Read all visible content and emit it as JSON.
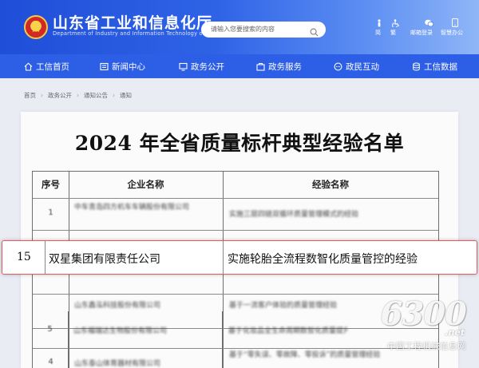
{
  "header": {
    "title": "山东省工业和信息化厅",
    "subtitle": "Department of Industry and Information Technology of Shandong Province",
    "search_placeholder": "请输入您要搜索的内容",
    "tools": [
      {
        "icon": "elder-mode-icon",
        "label": "简"
      },
      {
        "icon": "accessibility-icon",
        "label": "繁"
      },
      {
        "icon": "wechat-icon",
        "label": "邮箱登录"
      },
      {
        "icon": "phone-icon",
        "label": "智慧办公"
      }
    ]
  },
  "nav": {
    "items": [
      {
        "icon": "home-icon",
        "label": "工信首页"
      },
      {
        "icon": "news-icon",
        "label": "新闻中心"
      },
      {
        "icon": "monitor-icon",
        "label": "政务公开"
      },
      {
        "icon": "service-icon",
        "label": "政务服务"
      },
      {
        "icon": "chat-icon",
        "label": "政民互动"
      },
      {
        "icon": "data-icon",
        "label": "工信数据"
      }
    ]
  },
  "breadcrumb": [
    "首页",
    "政务公开",
    "通知公告",
    "通知"
  ],
  "document": {
    "title": "2024 年全省质量标杆典型经验名单",
    "table": {
      "headers": [
        "序号",
        "企业名称",
        "经验名称"
      ],
      "rows": [
        {
          "no": "1",
          "company": "中车青岛四方机车车辆股份有限公司",
          "experience": "实施三层四链双循环质量管理模式的经验"
        },
        {
          "no": "",
          "company": "",
          "experience": ""
        },
        {
          "no": "",
          "company": "山东鑫泓科技股份有限公司",
          "experience": "基于一流客户体验的质量管理经验"
        },
        {
          "no": "4",
          "company": "山东泰山体育器材有限公司",
          "experience": "基于“零失误、零故障、零投诉”的质量管理经验"
        },
        {
          "no": "5",
          "company": "山东福瑞达生物股份有限公司",
          "experience": "基于化妆品全生命周期数智化质量提升经验"
        }
      ],
      "highlight": {
        "no": "15",
        "company": "双星集团有限责任公司",
        "experience": "实施轮胎全流程数智化质量管控的经验"
      }
    }
  },
  "watermark": {
    "number": "6300",
    "domain": ".net",
    "caption": "中国工程机械信息网"
  },
  "colors": {
    "header_blue": "#2d5fe6",
    "highlight_border": "#e55a5a"
  }
}
